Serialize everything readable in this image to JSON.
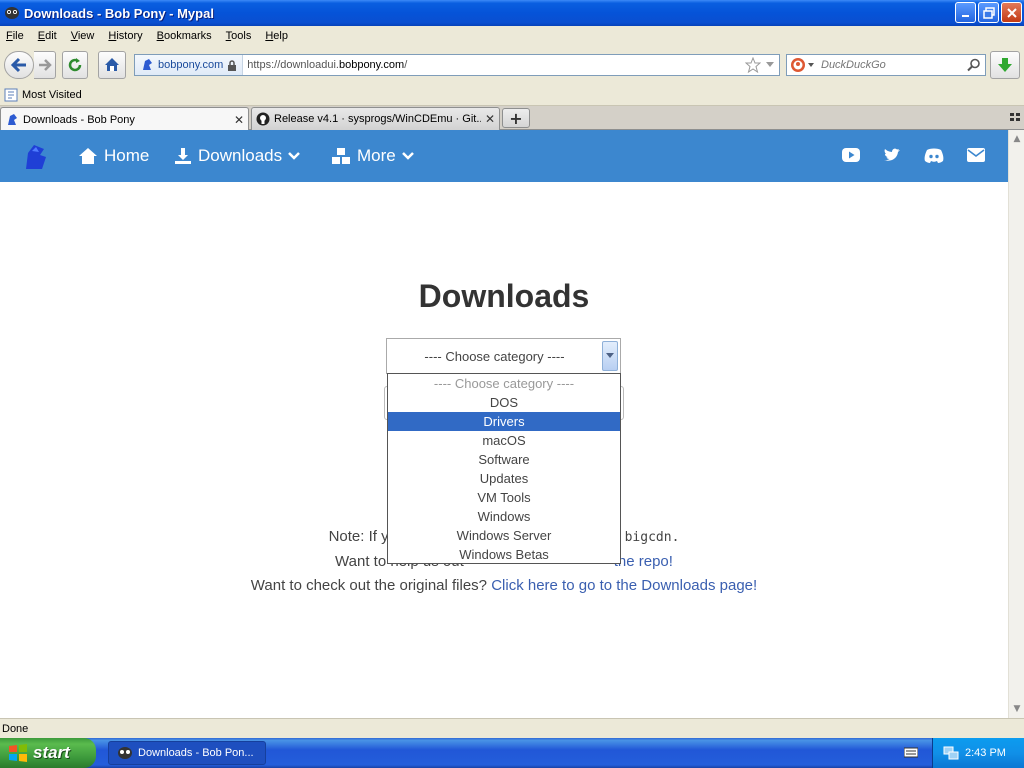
{
  "window": {
    "title": "Downloads - Bob Pony - Mypal"
  },
  "menubar": [
    "File",
    "Edit",
    "View",
    "History",
    "Bookmarks",
    "Tools",
    "Help"
  ],
  "urlbar": {
    "site_identity": "bobpony.com",
    "url_prefix": "https://downloadui.",
    "url_domain": "bobpony.com",
    "url_suffix": "/"
  },
  "search": {
    "placeholder": "DuckDuckGo"
  },
  "bookmarks": {
    "most_visited": "Most Visited"
  },
  "tabs": [
    {
      "label": "Downloads - Bob Pony",
      "active": true
    },
    {
      "label": "Release v4.1 · sysprogs/WinCDEmu · Git...",
      "active": false
    }
  ],
  "site_nav": {
    "home": "Home",
    "downloads": "Downloads",
    "more": "More",
    "accent_color": "#3c87cf"
  },
  "page": {
    "title": "Downloads",
    "select_value": "---- Choose category ----",
    "dropdown_options": [
      {
        "label": "---- Choose category ----",
        "kind": "placeholder"
      },
      {
        "label": "DOS",
        "kind": "normal"
      },
      {
        "label": "Drivers",
        "kind": "selected"
      },
      {
        "label": "macOS",
        "kind": "normal"
      },
      {
        "label": "Software",
        "kind": "normal"
      },
      {
        "label": "Updates",
        "kind": "normal"
      },
      {
        "label": "VM Tools",
        "kind": "normal"
      },
      {
        "label": "Windows",
        "kind": "normal"
      },
      {
        "label": "Windows Server",
        "kind": "normal"
      },
      {
        "label": "Windows Betas",
        "kind": "normal"
      }
    ],
    "note_start": "Note: If y",
    "note_end": "bigcdn.",
    "help_start": "Want to help us out",
    "help_link": "the repo!",
    "original_text": "Want to check out the original files?",
    "original_link": "Click here to go to the Downloads page!"
  },
  "status": {
    "text": "Done"
  },
  "taskbar": {
    "start_label": "start",
    "task_label": "Downloads - Bob Pon...",
    "clock": "2:43 PM"
  }
}
